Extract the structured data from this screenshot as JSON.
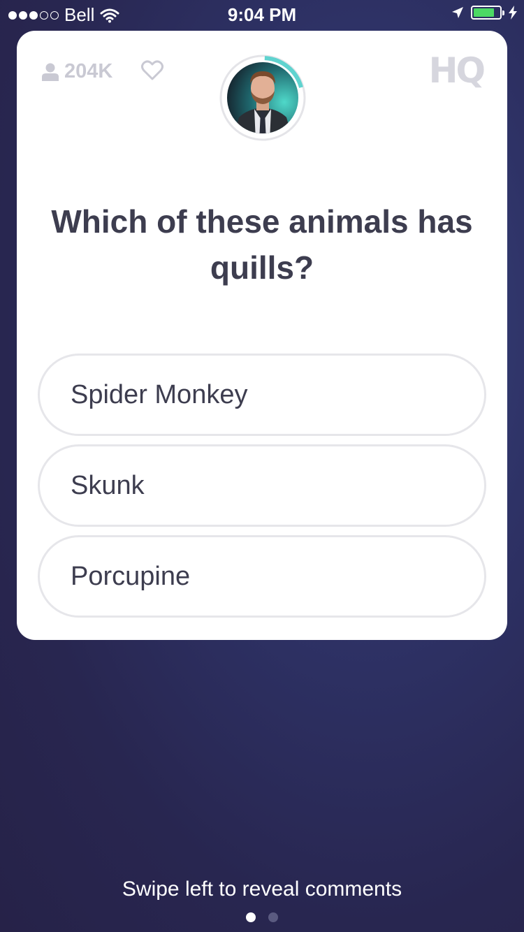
{
  "status_bar": {
    "carrier": "Bell",
    "time": "9:04 PM",
    "signal_bars_filled": 3,
    "signal_bars_total": 5,
    "battery_level": 0.8,
    "battery_color": "#4cd964",
    "icons": [
      "wifi-icon",
      "location-arrow-icon",
      "battery-icon",
      "charging-bolt-icon"
    ]
  },
  "game": {
    "viewer_count": "204K",
    "logo": "HQ",
    "host_icon": "host-avatar",
    "timer_progress": 0.2,
    "timer_color": "#5fd3cf"
  },
  "question": {
    "text": "Which of these animals has quills?"
  },
  "answers": [
    {
      "label": "Spider Monkey"
    },
    {
      "label": "Skunk"
    },
    {
      "label": "Porcupine"
    }
  ],
  "footer": {
    "hint": "Swipe left to reveal comments",
    "page_count": 2,
    "active_page": 1
  },
  "colors": {
    "text_dark": "#3d3d4f",
    "muted": "#c9c9d3",
    "card": "#ffffff"
  }
}
